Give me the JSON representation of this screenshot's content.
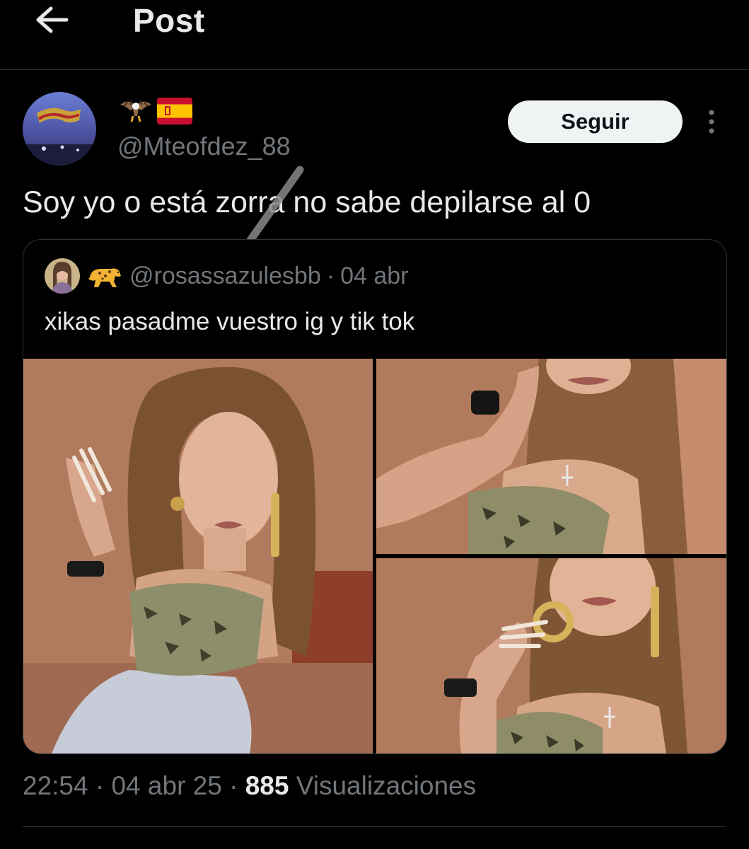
{
  "header": {
    "title": "Post"
  },
  "post": {
    "author_emojis": "🦅🇪🇸",
    "handle": "@Mteofdez_88",
    "follow_label": "Seguir",
    "text": "Soy yo o está zorra no sabe depilarse al 0"
  },
  "quote": {
    "emoji": "🐆",
    "handle": "@rosassazulesbb",
    "separator": "·",
    "date": "04 abr",
    "text": "xikas pasadme vuestro ig y tik tok",
    "photo_count": 3
  },
  "meta": {
    "time": "22:54",
    "separator": "·",
    "date": "04 abr 25",
    "views_count": "885",
    "views_label": "Visualizaciones"
  },
  "colors": {
    "background": "#000000",
    "text_primary": "#e7e9ea",
    "text_secondary": "#71767b",
    "border": "#2f3336",
    "follow_button": "#eff3f4"
  }
}
